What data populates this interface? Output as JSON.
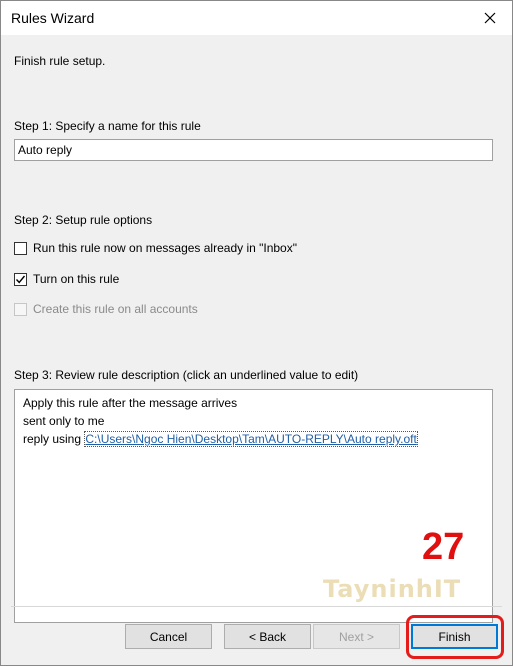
{
  "window": {
    "title": "Rules Wizard"
  },
  "intro": "Finish rule setup.",
  "step1": {
    "label": "Step 1: Specify a name for this rule",
    "rule_name": "Auto reply"
  },
  "step2": {
    "label": "Step 2: Setup rule options",
    "options": [
      {
        "label": "Run this rule now on messages already in \"Inbox\"",
        "checked": false,
        "enabled": true
      },
      {
        "label": "Turn on this rule",
        "checked": true,
        "enabled": true
      },
      {
        "label": "Create this rule on all accounts",
        "checked": false,
        "enabled": false
      }
    ]
  },
  "step3": {
    "label": "Step 3: Review rule description (click an underlined value to edit)",
    "line1": "Apply this rule after the message arrives",
    "line2": "sent only to me",
    "line3_prefix": "reply using ",
    "line3_link": "C:\\Users\\Ngoc Hien\\Desktop\\Tam\\AUTO-REPLY\\Auto reply.oft"
  },
  "buttons": {
    "cancel": "Cancel",
    "back": "< Back",
    "next": "Next >",
    "finish": "Finish"
  },
  "annotation": {
    "step_number": "27",
    "watermark": "TayninhIT"
  }
}
